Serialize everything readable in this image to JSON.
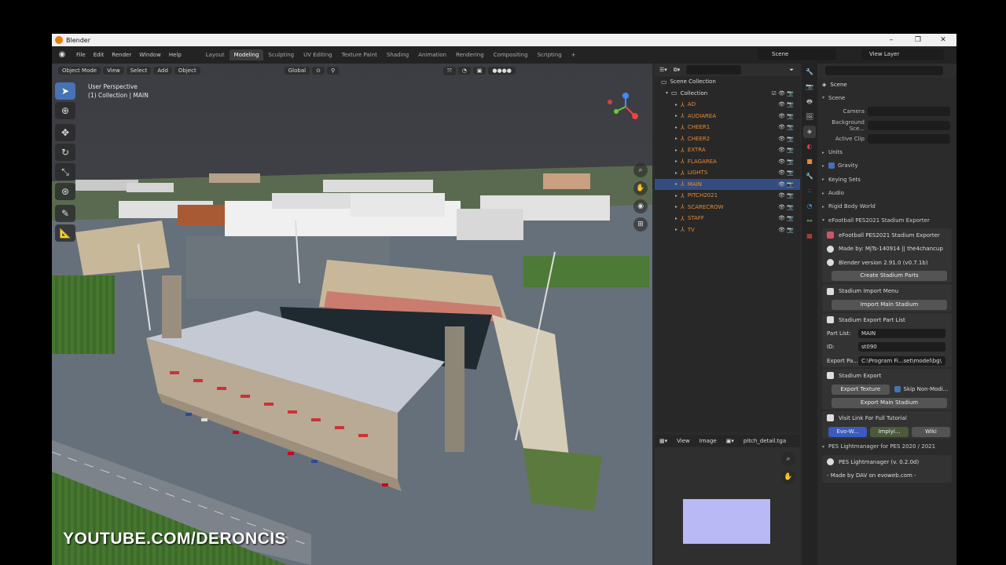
{
  "window": {
    "title": "Blender",
    "controls": [
      "–",
      "❐",
      "✕"
    ]
  },
  "menu": {
    "items": [
      "File",
      "Edit",
      "Render",
      "Window",
      "Help"
    ],
    "workspaces": [
      "Layout",
      "Modeling",
      "Sculpting",
      "UV Editing",
      "Texture Paint",
      "Shading",
      "Animation",
      "Rendering",
      "Compositing",
      "Scripting"
    ],
    "active_workspace": "Modeling",
    "scene": "Scene",
    "view_layer": "View Layer"
  },
  "viewport": {
    "mode": "Object Mode",
    "menus": [
      "View",
      "Select",
      "Add",
      "Object"
    ],
    "transform_orientation": "Global",
    "info_line1": "User Perspective",
    "info_line2": "(1) Collection | MAIN",
    "watermark": "YOUTUBE.COM/DERONCIS"
  },
  "outliner": {
    "root": "Scene Collection",
    "collection": "Collection",
    "items": [
      "AD",
      "AUDIAREA",
      "CHEER1",
      "CHEER2",
      "EXTRA",
      "FLAGAREA",
      "LIGHTS",
      "MAIN",
      "PITCH2021",
      "SCARECROW",
      "STAFF",
      "TV"
    ],
    "selected": "MAIN"
  },
  "image_editor": {
    "menus": [
      "View",
      "Image"
    ],
    "image_name": "pitch_detail.tga"
  },
  "properties": {
    "header": "Scene",
    "scene_section": "Scene",
    "camera_label": "Camera",
    "bg_label": "Background Sce...",
    "clip_label": "Active Clip",
    "sections": [
      "Units",
      "Gravity",
      "Keying Sets",
      "Audio",
      "Rigid Body World",
      "eFootball PES2021 Stadium Exporter"
    ],
    "exporter_title": "eFootball PES2021 Stadium Exporter",
    "made_by": "Made by: MjTs-140914 || the4chancup",
    "blender_version": "Blender version 2.91.0 (v0.7.1b)",
    "create_parts": "Create Stadium Parts",
    "import_menu": "Stadium Import Menu",
    "import_main": "Import Main Stadium",
    "export_part_list": "Stadium Export Part List",
    "part_list_label": "Part List:",
    "part_list_value": "MAIN",
    "id_label": "ID:",
    "id_value": "st090",
    "export_path_label": "Export Pa...",
    "export_path_value": "C:\\Program Fi...set\\model\\bg\\",
    "stadium_export": "Stadium Export",
    "export_texture": "Export Texture",
    "skip_non_modified": "Skip Non-Modi...",
    "export_main": "Export Main Stadium",
    "visit_link": "Visit Link For Full Tutorial",
    "link_buttons": [
      "Evo-W...",
      "Implyi...",
      "Wiki"
    ],
    "lightmanager_section": "PES Lightmanager for PES 2020 / 2021",
    "lightmanager": "PES Lightmanager (v. 0.2.0d)",
    "lightmanager_by": "- Made by DAV on evoweb.com -"
  }
}
